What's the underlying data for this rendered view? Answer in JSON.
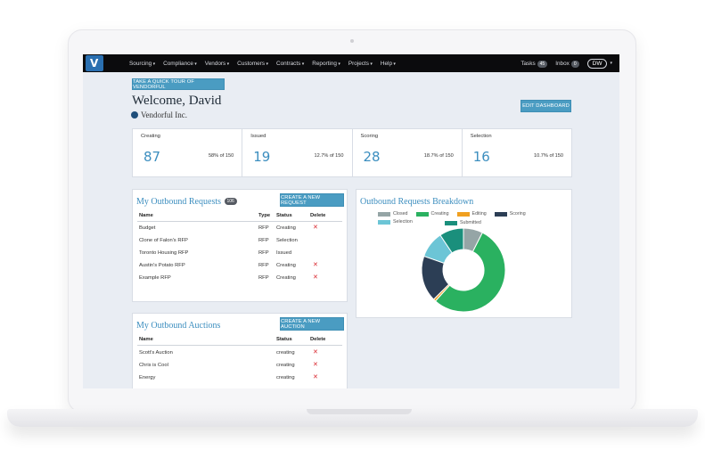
{
  "nav": {
    "items": [
      "Sourcing",
      "Compliance",
      "Vendors",
      "Customers",
      "Contracts",
      "Reporting",
      "Projects",
      "Help"
    ],
    "tasks_label": "Tasks",
    "tasks_count": "45",
    "inbox_label": "Inbox",
    "inbox_count": "0",
    "user_initials": "DW"
  },
  "header": {
    "tour_button": "TAKE A QUICK TOUR OF VENDORFUL",
    "welcome": "Welcome, David",
    "company": "Vendorful Inc.",
    "edit_button": "EDIT DASHBOARD"
  },
  "stats": [
    {
      "label": "Creating",
      "value": "87",
      "fraction": "58% of 150"
    },
    {
      "label": "Issued",
      "value": "19",
      "fraction": "12.7% of 150"
    },
    {
      "label": "Scoring",
      "value": "28",
      "fraction": "18.7% of 150"
    },
    {
      "label": "Selection",
      "value": "16",
      "fraction": "10.7% of 150"
    }
  ],
  "requests": {
    "title": "My Outbound Requests",
    "count": "106",
    "new_button": "CREATE A NEW REQUEST",
    "columns": [
      "Name",
      "Type",
      "Status",
      "Delete"
    ],
    "rows": [
      {
        "name": "Budget",
        "type": "RFP",
        "status": "Creating",
        "delete": "✕"
      },
      {
        "name": "Clone of Falon's RFP",
        "type": "RFP",
        "status": "Selection",
        "delete": ""
      },
      {
        "name": "Toronto Housing RFP",
        "type": "RFP",
        "status": "Issued",
        "delete": ""
      },
      {
        "name": "Austin's Potato RFP",
        "type": "RFP",
        "status": "Creating",
        "delete": "✕"
      },
      {
        "name": "Example RFP",
        "type": "RFP",
        "status": "Creating",
        "delete": "✕"
      }
    ]
  },
  "auctions": {
    "title": "My Outbound Auctions",
    "new_button": "CREATE A NEW AUCTION",
    "columns": [
      "Name",
      "Status",
      "Delete"
    ],
    "rows": [
      {
        "name": "Scott's Auction",
        "status": "creating",
        "delete": "✕"
      },
      {
        "name": "Chris is Cool",
        "status": "creating",
        "delete": "✕"
      },
      {
        "name": "Energy",
        "status": "creating",
        "delete": "✕"
      }
    ]
  },
  "chart_data": {
    "type": "pie",
    "title": "Outbound Requests Breakdown",
    "donut": true,
    "legend_placement": "top",
    "categories": [
      "Closed",
      "Creating",
      "Editing",
      "Scoring",
      "Selection",
      "Submitted"
    ],
    "values": [
      8,
      58,
      1,
      19,
      11,
      10
    ],
    "colors": [
      "#95a5a6",
      "#2ab160",
      "#f0a020",
      "#2c3e55",
      "#6cc5d6",
      "#1a8f7c"
    ]
  }
}
